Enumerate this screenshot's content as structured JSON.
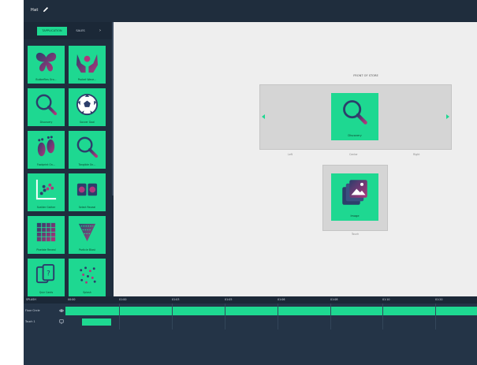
{
  "window": {
    "title": "Hat"
  },
  "sidebar": {
    "tabs": [
      {
        "label": "TAPPLICATION"
      },
      {
        "label": "SALES"
      }
    ],
    "tab_arrow": "›",
    "tiles": [
      {
        "label": "Butterflies Gro...",
        "icon": "butterfly-icon"
      },
      {
        "label": "Pocket Wave...",
        "icon": "hands-icon"
      },
      {
        "label": "Discovery",
        "icon": "magnifier-icon"
      },
      {
        "label": "Soccer Goal",
        "icon": "soccer-ball-icon"
      },
      {
        "label": "Footprint On...",
        "icon": "footprint-icon"
      },
      {
        "label": "Tangible On...",
        "icon": "magnifier-icon"
      },
      {
        "label": "Scatter Gather",
        "icon": "scatter-icon"
      },
      {
        "label": "Select Reveal",
        "icon": "reveal-icon"
      },
      {
        "label": "Pixelate Reveal",
        "icon": "pixel-grid-icon"
      },
      {
        "label": "Particle Blast",
        "icon": "particles-icon"
      },
      {
        "label": "Quiz Cards",
        "icon": "cards-icon"
      },
      {
        "label": "Splash",
        "icon": "splash-icon"
      }
    ]
  },
  "canvas": {
    "floor_title": "FRONT OF STORE",
    "floor_tile": {
      "label": "Discovery",
      "icon": "magnifier-icon"
    },
    "positions": [
      "Left",
      "Center",
      "Right"
    ],
    "screen_tile": {
      "label": "Image",
      "icon": "image-gallery-icon"
    },
    "screen_label": "Touch"
  },
  "timeline": {
    "name_label": "SPLASH",
    "ticks": [
      "00:00",
      "01:00",
      "01:03",
      "01:05",
      "01:06",
      "01:08",
      "01:10",
      "01:20"
    ],
    "tracks": [
      {
        "name": "Floor Circle",
        "icon": "eye-icon"
      },
      {
        "name": "Touch 1",
        "icon": "screen-icon"
      }
    ]
  },
  "colors": {
    "accent": "#1ed891",
    "dark_bg": "#243447",
    "canvas_bg": "#eeeeee",
    "icon_dark": "#2c3e6b",
    "icon_magenta": "#b0367c"
  }
}
